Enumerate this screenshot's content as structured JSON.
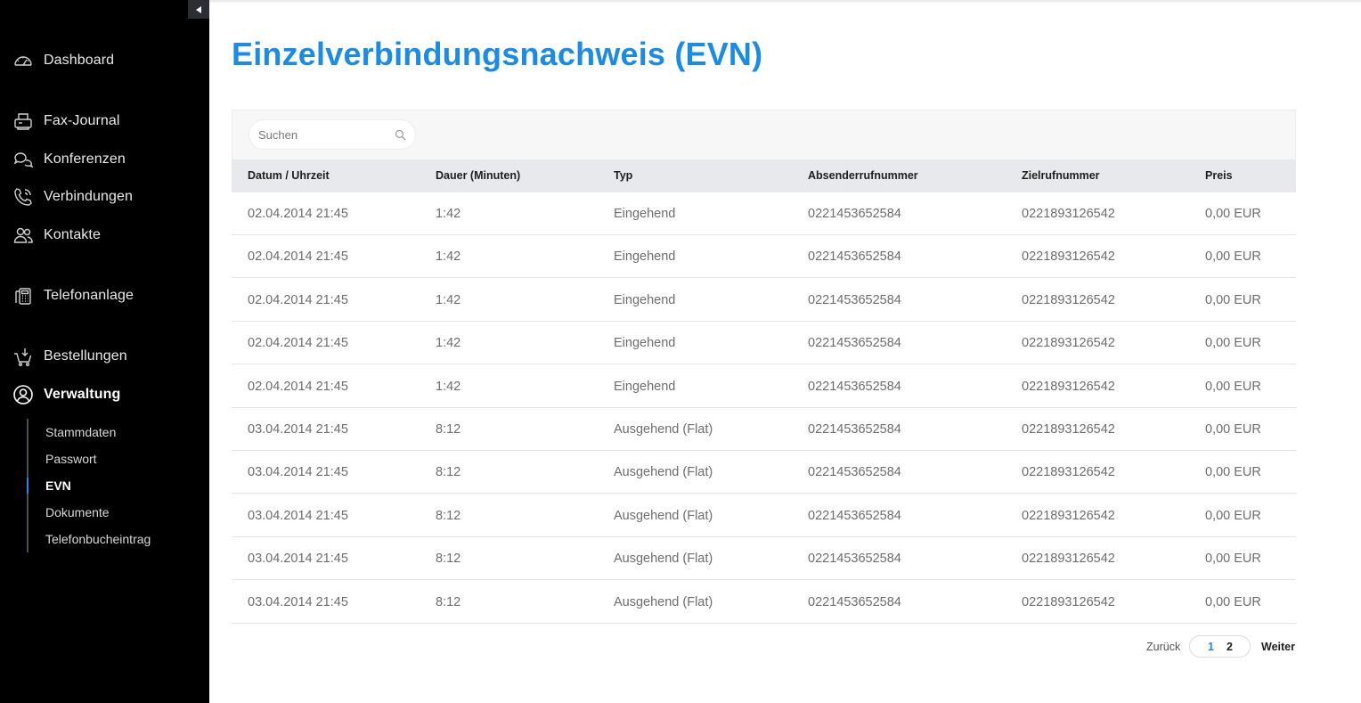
{
  "sidebar": {
    "collapse_label": "◀",
    "items": [
      {
        "label": "Dashboard",
        "icon": "speedometer-icon"
      },
      {
        "label": "Fax-Journal",
        "icon": "fax-icon"
      },
      {
        "label": "Konferenzen",
        "icon": "conference-icon"
      },
      {
        "label": "Verbindungen",
        "icon": "phone-icon"
      },
      {
        "label": "Kontakte",
        "icon": "contacts-icon"
      },
      {
        "label": "Telefonanlage",
        "icon": "phone-system-icon"
      },
      {
        "label": "Bestellungen",
        "icon": "cart-icon"
      },
      {
        "label": "Verwaltung",
        "icon": "user-admin-icon",
        "active": true
      }
    ],
    "subitems": [
      {
        "label": "Stammdaten"
      },
      {
        "label": "Passwort"
      },
      {
        "label": "EVN",
        "active": true
      },
      {
        "label": "Dokumente"
      },
      {
        "label": "Telefonbucheintrag"
      }
    ]
  },
  "page": {
    "title": "Einzelverbindungsnachweis (EVN)"
  },
  "search": {
    "placeholder": "Suchen"
  },
  "table": {
    "columns": [
      "Datum / Uhrzeit",
      "Dauer (Minuten)",
      "Typ",
      "Absenderrufnummer",
      "Zielrufnummer",
      "Preis"
    ],
    "rows": [
      [
        "02.04.2014 21:45",
        "1:42",
        "Eingehend",
        "0221453652584",
        "0221893126542",
        "0,00 EUR"
      ],
      [
        "02.04.2014 21:45",
        "1:42",
        "Eingehend",
        "0221453652584",
        "0221893126542",
        "0,00 EUR"
      ],
      [
        "02.04.2014 21:45",
        "1:42",
        "Eingehend",
        "0221453652584",
        "0221893126542",
        "0,00 EUR"
      ],
      [
        "02.04.2014 21:45",
        "1:42",
        "Eingehend",
        "0221453652584",
        "0221893126542",
        "0,00 EUR"
      ],
      [
        "02.04.2014 21:45",
        "1:42",
        "Eingehend",
        "0221453652584",
        "0221893126542",
        "0,00 EUR"
      ],
      [
        "03.04.2014 21:45",
        "8:12",
        "Ausgehend (Flat)",
        "0221453652584",
        "0221893126542",
        "0,00 EUR"
      ],
      [
        "03.04.2014 21:45",
        "8:12",
        "Ausgehend (Flat)",
        "0221453652584",
        "0221893126542",
        "0,00 EUR"
      ],
      [
        "03.04.2014 21:45",
        "8:12",
        "Ausgehend (Flat)",
        "0221453652584",
        "0221893126542",
        "0,00 EUR"
      ],
      [
        "03.04.2014 21:45",
        "8:12",
        "Ausgehend (Flat)",
        "0221453652584",
        "0221893126542",
        "0,00 EUR"
      ],
      [
        "03.04.2014 21:45",
        "8:12",
        "Ausgehend (Flat)",
        "0221453652584",
        "0221893126542",
        "0,00 EUR"
      ]
    ]
  },
  "pagination": {
    "prev_label": "Zurück",
    "pages": [
      "1",
      "2"
    ],
    "current": "1",
    "next_label": "Weiter"
  },
  "colors": {
    "accent": "#1a8be6",
    "sidebar_bg": "#000000",
    "header_bg": "#e8e9ec"
  }
}
